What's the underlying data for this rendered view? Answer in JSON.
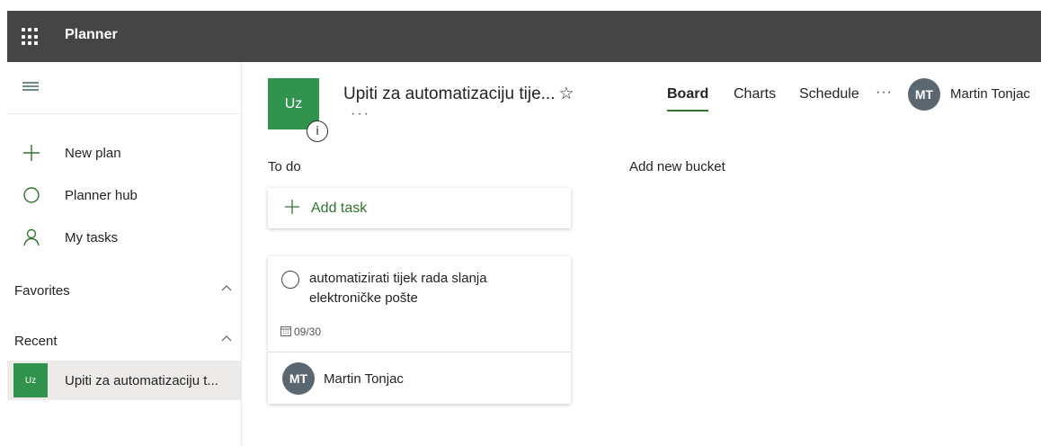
{
  "app": {
    "title": "Planner"
  },
  "sidebar": {
    "nav": [
      {
        "label": "New plan",
        "icon": "plus-icon"
      },
      {
        "label": "Planner hub",
        "icon": "circle-icon"
      },
      {
        "label": "My tasks",
        "icon": "person-icon"
      }
    ],
    "favorites_label": "Favorites",
    "recent_label": "Recent",
    "recent_items": [
      {
        "initials": "Uz",
        "label": "Upiti za automatizaciju t..."
      }
    ]
  },
  "plan": {
    "initials": "Uz",
    "info_glyph": "i",
    "title": "Upiti za automatizaciju tije...",
    "star": "☆",
    "more": "···"
  },
  "tabs": [
    "Board",
    "Charts",
    "Schedule"
  ],
  "header_more": "···",
  "user": {
    "initials": "MT",
    "name": "Martin Tonjac"
  },
  "board": {
    "buckets": [
      {
        "name": "To do",
        "add_task_label": "Add task",
        "tasks": [
          {
            "title": "automatizirati tijek rada slanja elektroničke pošte",
            "due": "09/30",
            "assignee_initials": "MT",
            "assignee": "Martin Tonjac"
          }
        ]
      }
    ],
    "add_bucket_label": "Add new bucket"
  },
  "colors": {
    "accent": "#31752f",
    "tile": "#31934d",
    "topbar": "#454545",
    "avatar": "#5a6770"
  }
}
